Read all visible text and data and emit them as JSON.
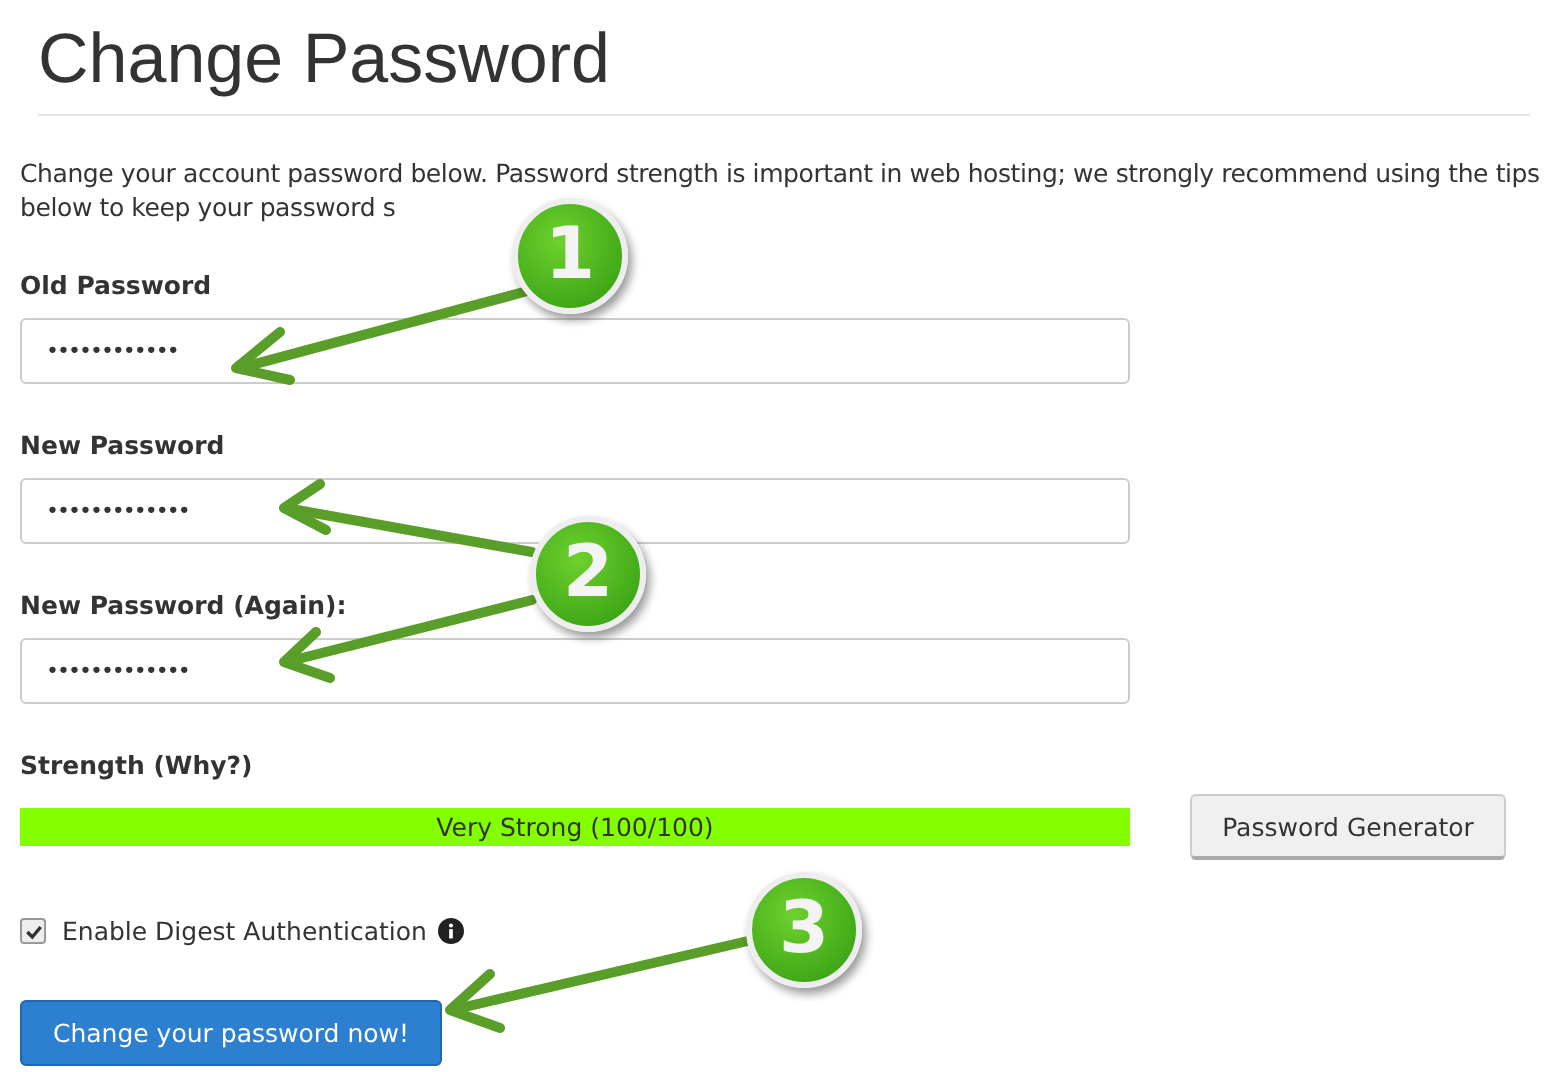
{
  "title": "Change Password",
  "description": "Change your account password below. Password strength is important in web hosting; we strongly recommend using the tips below to keep your password s",
  "fields": [
    {
      "label": "Old Password",
      "value": "••••••••••••"
    },
    {
      "label": "New Password",
      "value": "•••••••••••••"
    },
    {
      "label": "New Password (Again):",
      "value": "•••••••••••••"
    }
  ],
  "strength": {
    "label": "Strength (Why?)",
    "text": "Very Strong (100/100)",
    "level": 1
  },
  "generator_button": "Password Generator",
  "digest": {
    "label": "Enable Digest Authentication",
    "checked": true
  },
  "submit_button": "Change your password now!",
  "annotations": [
    {
      "number": "1"
    },
    {
      "number": "2"
    },
    {
      "number": "3"
    }
  ]
}
